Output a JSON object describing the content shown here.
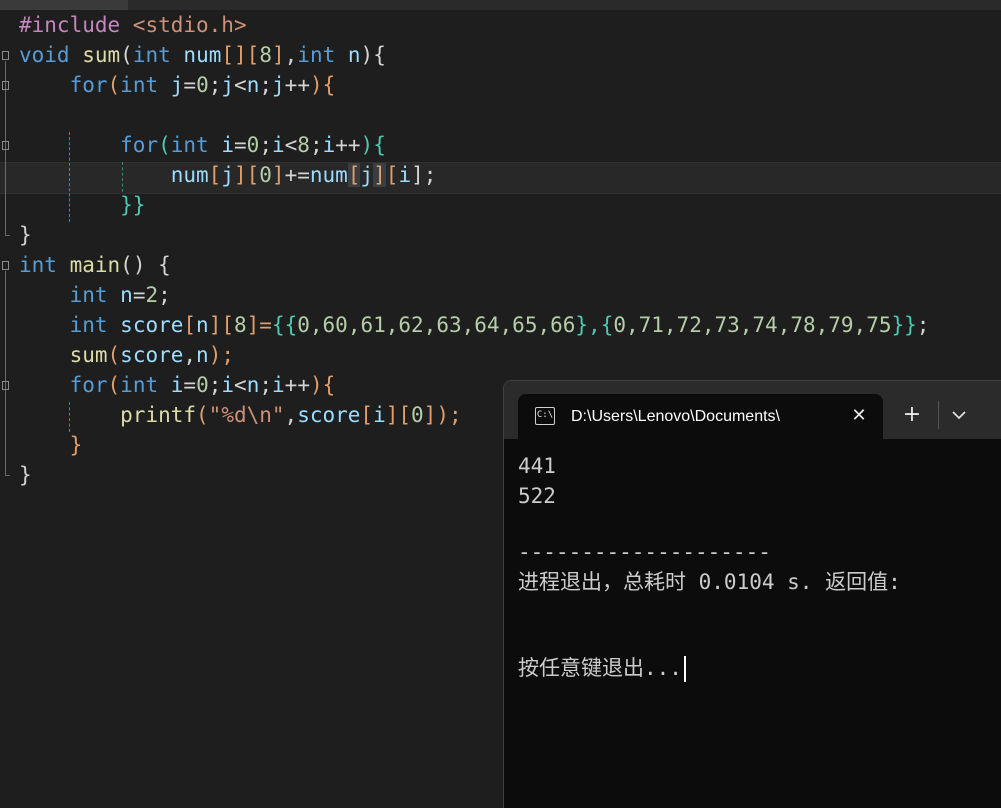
{
  "editor": {
    "lines": {
      "l1": {
        "a": "#include ",
        "b": "<stdio.h>"
      },
      "l2": {
        "a": "void",
        "b": " ",
        "c": "sum",
        "d": "(",
        "e": "int",
        "f": " ",
        "g": "num",
        "h": "[",
        "i": "]",
        "j": "[",
        "k": "8",
        "l": "]",
        "m": ",",
        "n": "int",
        "o": " ",
        "p": "n",
        "q": "){"
      },
      "l3": {
        "a": "    ",
        "b": "for",
        "c": "(",
        "d": "int",
        "e": " ",
        "f": "j",
        "g": "=",
        "h": "0",
        "i": ";",
        "j": "j",
        "k": "<",
        "l": "n",
        "m": ";",
        "n": "j",
        "o": "++",
        "p": "){"
      },
      "l5": {
        "a": "        ",
        "b": "for",
        "c": "(",
        "d": "int",
        "e": " ",
        "f": "i",
        "g": "=",
        "h": "0",
        "i": ";",
        "j": "i",
        "k": "<",
        "l": "8",
        "m": ";",
        "n": "i",
        "o": "++",
        "p": "){"
      },
      "l6": {
        "a": "            ",
        "b": "num",
        "c": "[",
        "d": "j",
        "e": "][",
        "f": "0",
        "g": "]",
        "h": "+=",
        "i": "num",
        "j": "[",
        "k": "j",
        "l": "]",
        "m": "[",
        "n": "i",
        "o": "];"
      },
      "l7": {
        "a": "        ",
        "b": "}}"
      },
      "l8": {
        "a": "}"
      },
      "l9": {
        "a": "int",
        "b": " ",
        "c": "main",
        "d": "() {"
      },
      "l10": {
        "a": "    ",
        "b": "int",
        "c": " ",
        "d": "n",
        "e": "=",
        "f": "2",
        "g": ";"
      },
      "l11": {
        "a": "    ",
        "b": "int",
        "c": " ",
        "d": "score",
        "e": "[",
        "f": "n",
        "g": "][",
        "h": "8",
        "i": "]=",
        "j": "{{",
        "k": "0,60,61,62,63,64,65,66",
        "l": "},{",
        "m": "0,71,72,73,74,78,79,75",
        "n": "}}",
        "o": ";"
      },
      "l12": {
        "a": "    ",
        "b": "sum",
        "c": "(",
        "d": "score",
        "e": ",",
        "f": "n",
        "g": ");"
      },
      "l13": {
        "a": "    ",
        "b": "for",
        "c": "(",
        "d": "int",
        "e": " ",
        "f": "i",
        "g": "=",
        "h": "0",
        "i": ";",
        "j": "i",
        "k": "<",
        "l": "n",
        "m": ";",
        "n": "i",
        "o": "++",
        "p": "){"
      },
      "l14": {
        "a": "        ",
        "b": "printf",
        "c": "(",
        "d": "\"%d\\n\"",
        "e": ",",
        "f": "score",
        "g": "[",
        "h": "i",
        "i": "][",
        "j": "0",
        "k": "]",
        "l": ");"
      },
      "l15": {
        "a": "    ",
        "b": "}"
      },
      "l16": {
        "a": "}"
      }
    }
  },
  "terminal": {
    "tab_icon": "C:\\",
    "tab_title": "D:\\Users\\Lenovo\\Documents\\",
    "close_glyph": "✕",
    "new_tab_glyph": "+",
    "output": {
      "line1": "441",
      "line2": "522",
      "separator": "--------------------",
      "exit_msg": "进程退出，总耗时 0.0104 s. 返回值:",
      "press_key": "按任意键退出..."
    }
  },
  "colors": {
    "editor_bg": "#1e1e1e",
    "terminal_bg": "#0c0c0c",
    "keyword": "#569cd6",
    "function": "#dcdcaa",
    "variable": "#9cdcfe",
    "number": "#b5cea8",
    "string": "#ce9178",
    "preprocessor": "#c586c0"
  }
}
